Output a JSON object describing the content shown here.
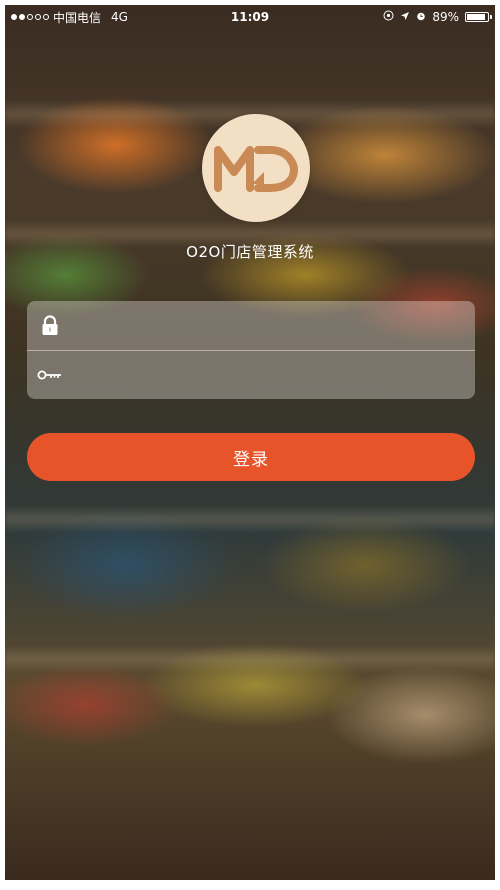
{
  "status_bar": {
    "carrier": "中国电信",
    "network": "4G",
    "time": "11:09",
    "battery": "89%",
    "battery_level": 0.89
  },
  "app": {
    "title": "O2O门店管理系统",
    "logo_text": "MD",
    "logo_icon": "md-logo-icon"
  },
  "login": {
    "username_placeholder": "",
    "password_placeholder": "",
    "username_icon": "lock-icon",
    "password_icon": "key-icon",
    "submit_label": "登录"
  },
  "colors": {
    "accent": "#e8542a",
    "logo_bg": "#f3dfc4",
    "logo_fg": "#c98a55"
  }
}
